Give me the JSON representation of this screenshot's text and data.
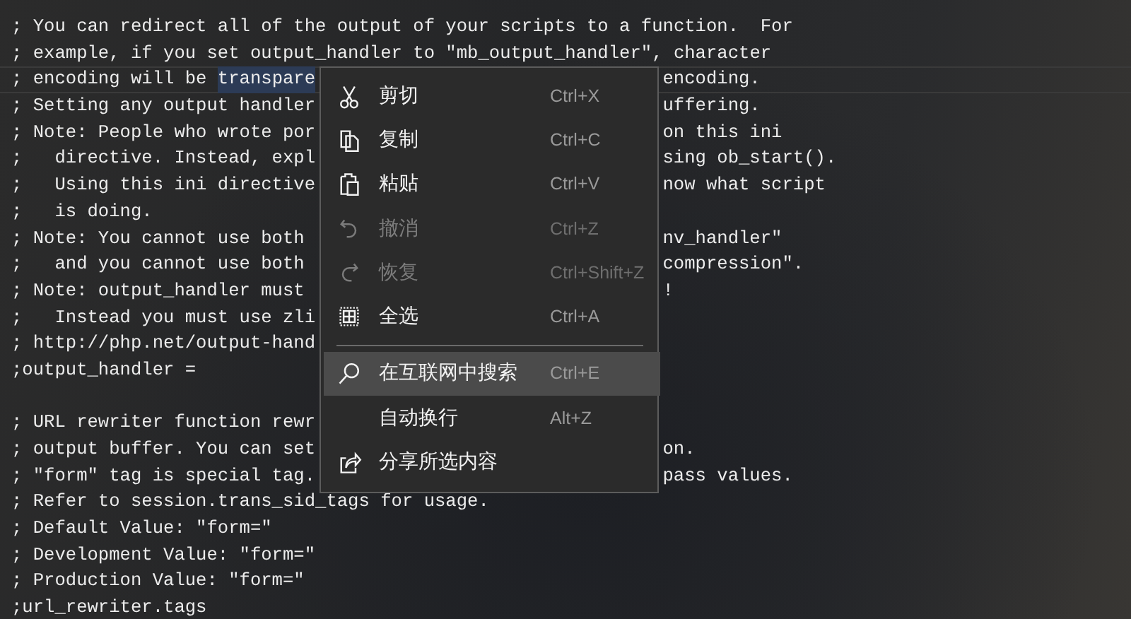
{
  "editor": {
    "lines": [
      {
        "kind": "code",
        "left": "; You can redirect all of the output of your scripts to a function.  For"
      },
      {
        "kind": "code",
        "left": "; example, if you set output_handler to \"mb_output_handler\", character"
      },
      {
        "kind": "code",
        "left": "; encoding will be ",
        "selected_text": "transpare",
        "right": "encoding.",
        "current": true
      },
      {
        "kind": "code",
        "left": "; Setting any output handler",
        "right": "uffering."
      },
      {
        "kind": "code",
        "left": "; Note: People who wrote por",
        "right": "on this ini"
      },
      {
        "kind": "code",
        "left": ";   directive. Instead, expl",
        "right": "sing ob_start()."
      },
      {
        "kind": "code",
        "left": ";   Using this ini directive",
        "right": "now what script"
      },
      {
        "kind": "code",
        "left": ";   is doing."
      },
      {
        "kind": "code",
        "left": "; Note: You cannot use both",
        "right": "nv_handler\""
      },
      {
        "kind": "code",
        "left": ";   and you cannot use both",
        "right": "compression\"."
      },
      {
        "kind": "code",
        "left": "; Note: output_handler must",
        "right": "!"
      },
      {
        "kind": "code",
        "left": ";   Instead you must use zli"
      },
      {
        "kind": "code",
        "left": "; http://php.net/output-hand"
      },
      {
        "kind": "code",
        "left": ";output_handler ="
      },
      {
        "kind": "blank"
      },
      {
        "kind": "code",
        "left": "; URL rewriter function rewr"
      },
      {
        "kind": "code",
        "left": "; output buffer. You can set",
        "right": "on."
      },
      {
        "kind": "code",
        "left": "; \"form\" tag is special tag.",
        "right": "pass values."
      },
      {
        "kind": "code",
        "left": "; Refer to session.trans_sid_tags for usage."
      },
      {
        "kind": "code",
        "left": "; Default Value: \"form=\""
      },
      {
        "kind": "code",
        "left": "; Development Value: \"form=\""
      },
      {
        "kind": "code",
        "left": "; Production Value: \"form=\""
      },
      {
        "kind": "code",
        "left": ";url_rewriter.tags"
      }
    ]
  },
  "context_menu": {
    "items": [
      {
        "kind": "item",
        "label": "剪切",
        "shortcut": "Ctrl+X",
        "disabled": false,
        "selected": false
      },
      {
        "kind": "item",
        "label": "复制",
        "shortcut": "Ctrl+C",
        "disabled": false,
        "selected": false
      },
      {
        "kind": "item",
        "label": "粘贴",
        "shortcut": "Ctrl+V",
        "disabled": false,
        "selected": false
      },
      {
        "kind": "item",
        "label": "撤消",
        "shortcut": "Ctrl+Z",
        "disabled": true,
        "selected": false
      },
      {
        "kind": "item",
        "label": "恢复",
        "shortcut": "Ctrl+Shift+Z",
        "disabled": true,
        "selected": false
      },
      {
        "kind": "item",
        "label": "全选",
        "shortcut": "Ctrl+A",
        "disabled": false,
        "selected": false
      },
      {
        "kind": "separator"
      },
      {
        "kind": "item",
        "label": "在互联网中搜索",
        "shortcut": "Ctrl+E",
        "disabled": false,
        "selected": true
      },
      {
        "kind": "item",
        "label": "自动换行",
        "shortcut": "Alt+Z",
        "disabled": false,
        "selected": false
      },
      {
        "kind": "item",
        "label": "分享所选内容",
        "disabled": false,
        "selected": false
      }
    ]
  }
}
